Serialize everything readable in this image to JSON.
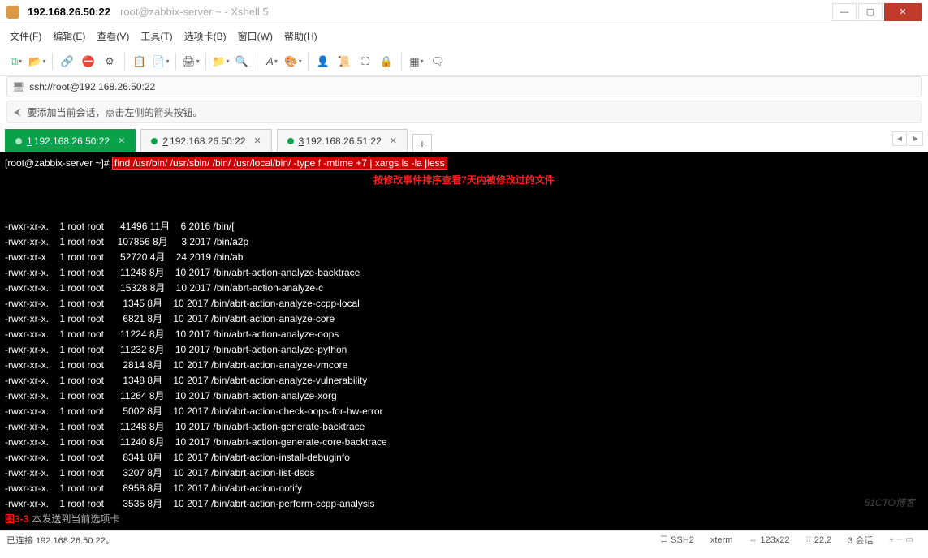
{
  "window": {
    "title_primary": "192.168.26.50:22",
    "title_secondary": "root@zabbix-server:~ - Xshell 5"
  },
  "menubar": [
    "文件(F)",
    "编辑(E)",
    "查看(V)",
    "工具(T)",
    "选项卡(B)",
    "窗口(W)",
    "帮助(H)"
  ],
  "urlbar": {
    "value": "ssh://root@192.168.26.50:22"
  },
  "infobar": {
    "text": "要添加当前会话，点击左侧的箭头按钮。"
  },
  "tabs": [
    {
      "idx": "1",
      "label": "192.168.26.50:22",
      "active": true
    },
    {
      "idx": "2",
      "label": "192.168.26.50:22",
      "active": false
    },
    {
      "idx": "3",
      "label": "192.168.26.51:22",
      "active": false
    }
  ],
  "terminal": {
    "prompt": "[root@zabbix-server ~]# ",
    "command": "find /usr/bin/ /usr/sbin/ /bin/ /usr/local/bin/ -type f -mtime +7 | xargs ls -la |less",
    "annotation": "按修改事件排序查看7天内被修改过的文件",
    "rows": [
      {
        "perm": "-rwxr-xr-x.",
        "links": "1",
        "user": "root",
        "group": "root",
        "size": "41496",
        "month": "11月",
        "day": "6",
        "year": "2016",
        "path": "/bin/["
      },
      {
        "perm": "-rwxr-xr-x.",
        "links": "1",
        "user": "root",
        "group": "root",
        "size": "107856",
        "month": "8月",
        "day": "3",
        "year": "2017",
        "path": "/bin/a2p"
      },
      {
        "perm": "-rwxr-xr-x",
        "links": "1",
        "user": "root",
        "group": "root",
        "size": "52720",
        "month": "4月",
        "day": "24",
        "year": "2019",
        "path": "/bin/ab"
      },
      {
        "perm": "-rwxr-xr-x.",
        "links": "1",
        "user": "root",
        "group": "root",
        "size": "11248",
        "month": "8月",
        "day": "10",
        "year": "2017",
        "path": "/bin/abrt-action-analyze-backtrace"
      },
      {
        "perm": "-rwxr-xr-x.",
        "links": "1",
        "user": "root",
        "group": "root",
        "size": "15328",
        "month": "8月",
        "day": "10",
        "year": "2017",
        "path": "/bin/abrt-action-analyze-c"
      },
      {
        "perm": "-rwxr-xr-x.",
        "links": "1",
        "user": "root",
        "group": "root",
        "size": "1345",
        "month": "8月",
        "day": "10",
        "year": "2017",
        "path": "/bin/abrt-action-analyze-ccpp-local"
      },
      {
        "perm": "-rwxr-xr-x.",
        "links": "1",
        "user": "root",
        "group": "root",
        "size": "6821",
        "month": "8月",
        "day": "10",
        "year": "2017",
        "path": "/bin/abrt-action-analyze-core"
      },
      {
        "perm": "-rwxr-xr-x.",
        "links": "1",
        "user": "root",
        "group": "root",
        "size": "11224",
        "month": "8月",
        "day": "10",
        "year": "2017",
        "path": "/bin/abrt-action-analyze-oops"
      },
      {
        "perm": "-rwxr-xr-x.",
        "links": "1",
        "user": "root",
        "group": "root",
        "size": "11232",
        "month": "8月",
        "day": "10",
        "year": "2017",
        "path": "/bin/abrt-action-analyze-python"
      },
      {
        "perm": "-rwxr-xr-x.",
        "links": "1",
        "user": "root",
        "group": "root",
        "size": "2814",
        "month": "8月",
        "day": "10",
        "year": "2017",
        "path": "/bin/abrt-action-analyze-vmcore"
      },
      {
        "perm": "-rwxr-xr-x.",
        "links": "1",
        "user": "root",
        "group": "root",
        "size": "1348",
        "month": "8月",
        "day": "10",
        "year": "2017",
        "path": "/bin/abrt-action-analyze-vulnerability"
      },
      {
        "perm": "-rwxr-xr-x.",
        "links": "1",
        "user": "root",
        "group": "root",
        "size": "11264",
        "month": "8月",
        "day": "10",
        "year": "2017",
        "path": "/bin/abrt-action-analyze-xorg"
      },
      {
        "perm": "-rwxr-xr-x.",
        "links": "1",
        "user": "root",
        "group": "root",
        "size": "5002",
        "month": "8月",
        "day": "10",
        "year": "2017",
        "path": "/bin/abrt-action-check-oops-for-hw-error"
      },
      {
        "perm": "-rwxr-xr-x.",
        "links": "1",
        "user": "root",
        "group": "root",
        "size": "11248",
        "month": "8月",
        "day": "10",
        "year": "2017",
        "path": "/bin/abrt-action-generate-backtrace"
      },
      {
        "perm": "-rwxr-xr-x.",
        "links": "1",
        "user": "root",
        "group": "root",
        "size": "11240",
        "month": "8月",
        "day": "10",
        "year": "2017",
        "path": "/bin/abrt-action-generate-core-backtrace"
      },
      {
        "perm": "-rwxr-xr-x.",
        "links": "1",
        "user": "root",
        "group": "root",
        "size": "8341",
        "month": "8月",
        "day": "10",
        "year": "2017",
        "path": "/bin/abrt-action-install-debuginfo"
      },
      {
        "perm": "-rwxr-xr-x.",
        "links": "1",
        "user": "root",
        "group": "root",
        "size": "3207",
        "month": "8月",
        "day": "10",
        "year": "2017",
        "path": "/bin/abrt-action-list-dsos"
      },
      {
        "perm": "-rwxr-xr-x.",
        "links": "1",
        "user": "root",
        "group": "root",
        "size": "8958",
        "month": "8月",
        "day": "10",
        "year": "2017",
        "path": "/bin/abrt-action-notify"
      },
      {
        "perm": "-rwxr-xr-x.",
        "links": "1",
        "user": "root",
        "group": "root",
        "size": "3535",
        "month": "8月",
        "day": "10",
        "year": "2017",
        "path": "/bin/abrt-action-perform-ccpp-analysis"
      }
    ],
    "bottom_msg": "本发送到当前选项卡",
    "figure_label": "图3-3"
  },
  "statusbar": {
    "left": "已连接 192.168.26.50:22。",
    "ssh": "SSH2",
    "term": "xterm",
    "size": "123x22",
    "pos": "22,2",
    "sessions": "3 会话"
  },
  "watermark": "51CTO博客"
}
